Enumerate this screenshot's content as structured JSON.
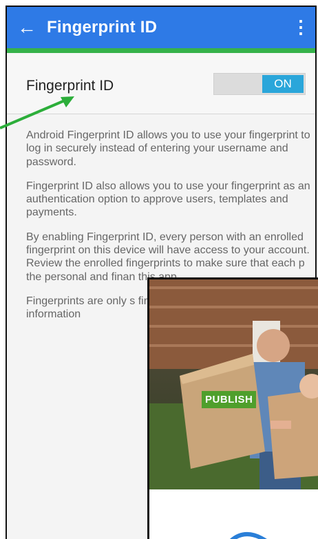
{
  "appbar": {
    "title": "Fingerprint ID",
    "back_icon": "arrow-left-icon",
    "menu_icon": "more-vert-icon",
    "color": "#2e7ae6",
    "accent": "#36b24a"
  },
  "setting": {
    "label": "Fingerprint ID",
    "toggle_state": "ON",
    "toggle_color": "#2aa6da"
  },
  "body": {
    "paragraphs": [
      "Android Fingerprint ID allows you to use your fingerprint to log in securely instead of entering your username and password.",
      "Fingerprint ID also allows you to use your fingerprint as an authentication option to approve users, templates and payments.",
      "By enabling Fingerprint ID, every person with an enrolled fingerprint on this device will have access to your account. Review the enrolled fingerprints to make sure that each p the personal and finan this app.",
      "Fingerprints are only s financial institution do fingerprint information"
    ]
  },
  "overlay": {
    "tag": "PUBLISH"
  }
}
